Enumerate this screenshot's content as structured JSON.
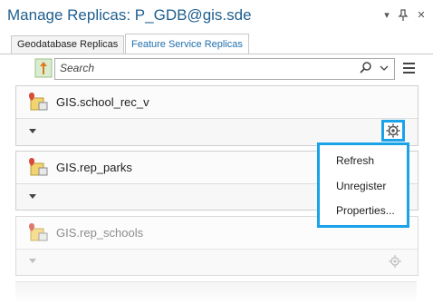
{
  "window": {
    "title": "Manage Replicas: P_GDB@gis.sde",
    "menu_glyph": "▾",
    "pin_glyph": "📌",
    "close_glyph": "✕"
  },
  "tabs": [
    {
      "label": "Geodatabase Replicas",
      "active": false
    },
    {
      "label": "Feature Service Replicas",
      "active": true
    }
  ],
  "search": {
    "placeholder": "Search"
  },
  "replicas": [
    {
      "name": "GIS.school_rec_v"
    },
    {
      "name": "GIS.rep_parks"
    },
    {
      "name": "GIS.rep_schools"
    }
  ],
  "context_menu": {
    "items": [
      "Refresh",
      "Unregister",
      "Properties..."
    ]
  },
  "colors": {
    "accent": "#1aa3e8",
    "title": "#1f5f8f"
  }
}
